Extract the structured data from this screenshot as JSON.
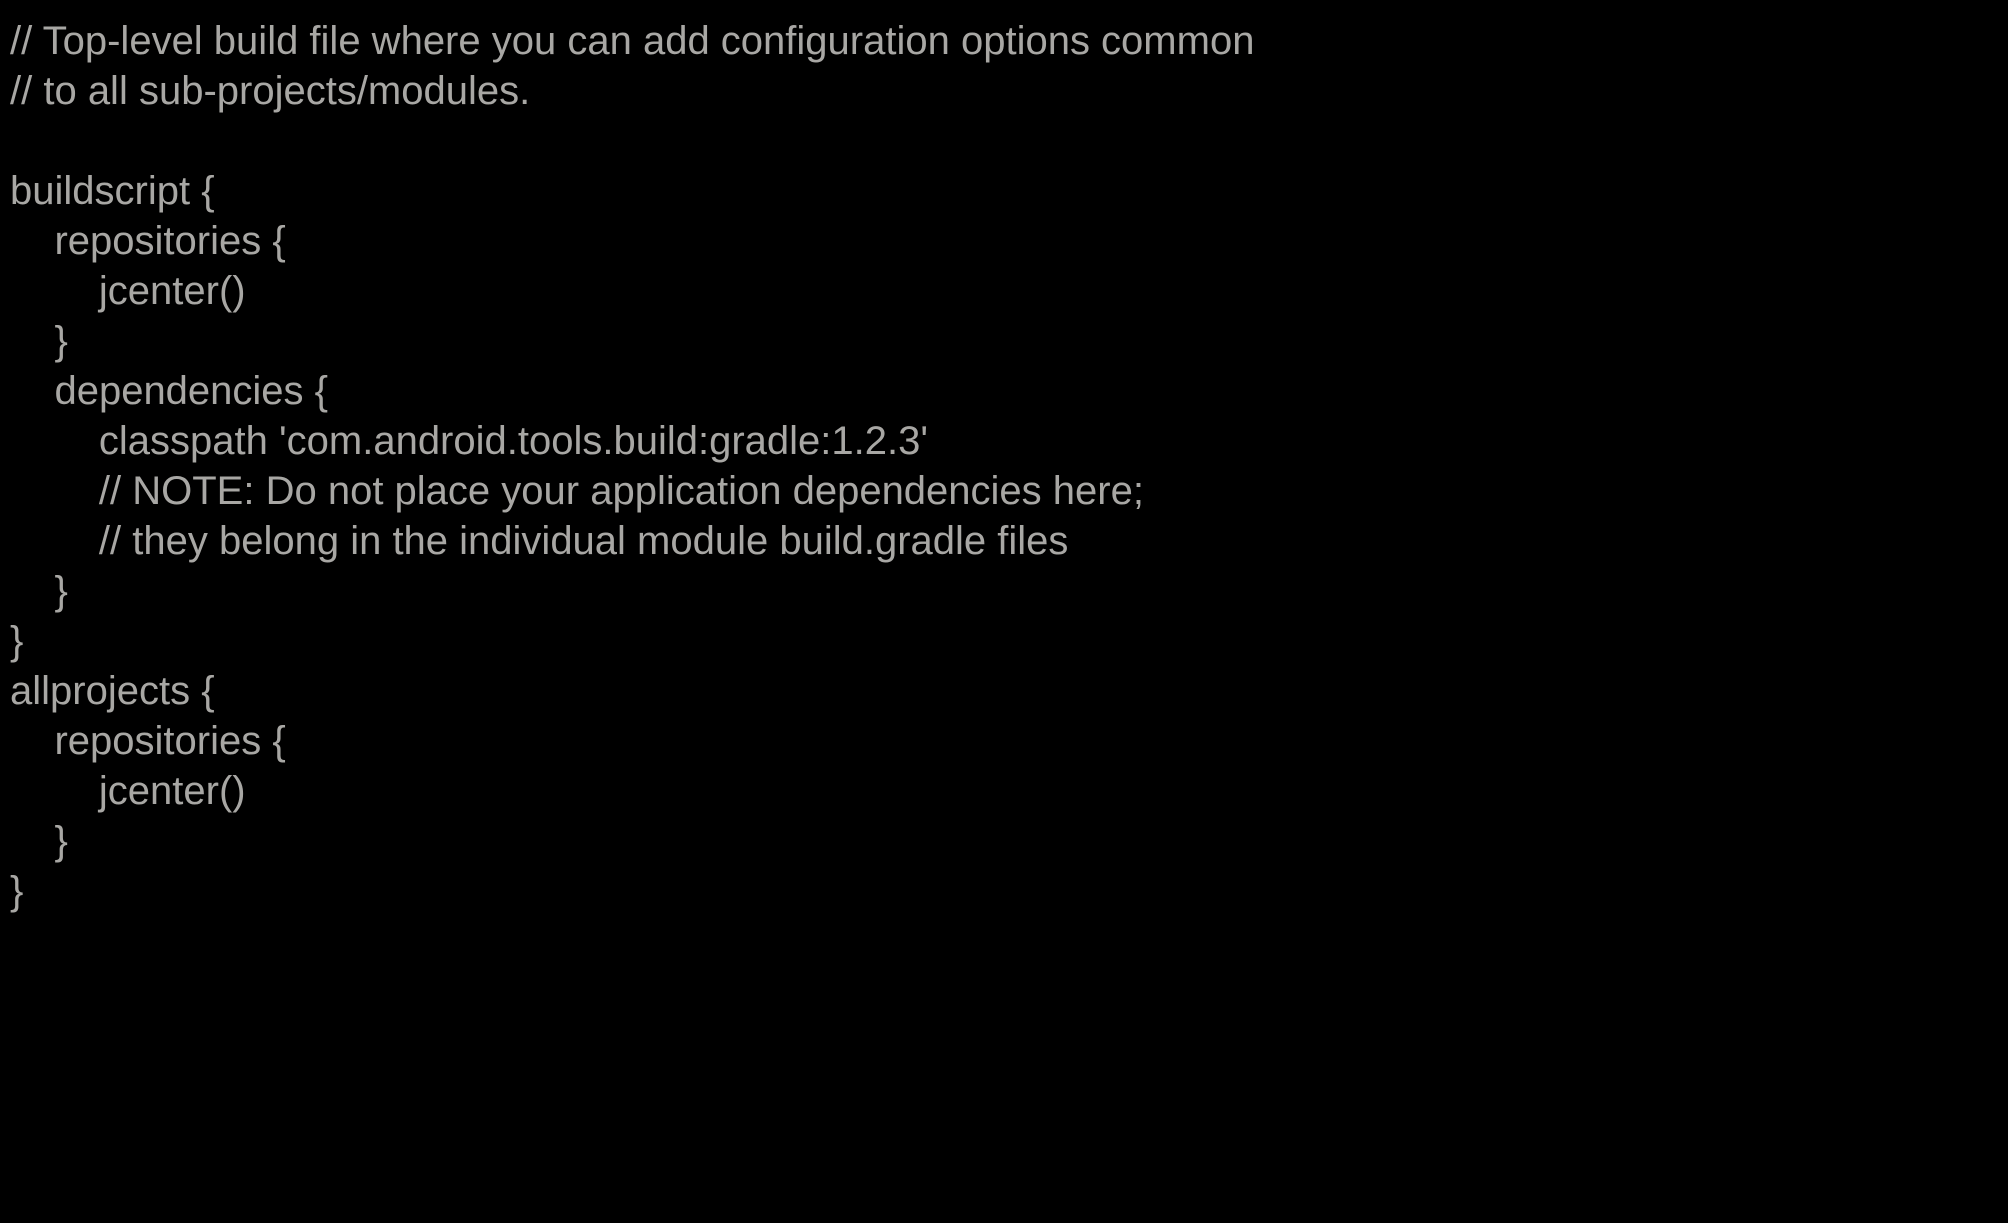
{
  "code": {
    "lines": [
      "// Top-level build file where you can add configuration options common",
      "// to all sub-projects/modules.",
      "",
      "buildscript {",
      "    repositories {",
      "        jcenter()",
      "    }",
      "    dependencies {",
      "        classpath 'com.android.tools.build:gradle:1.2.3'",
      "        // NOTE: Do not place your application dependencies here;",
      "        // they belong in the individual module build.gradle files",
      "    }",
      "}",
      "allprojects {",
      "    repositories {",
      "        jcenter()",
      "    }",
      "}"
    ]
  }
}
